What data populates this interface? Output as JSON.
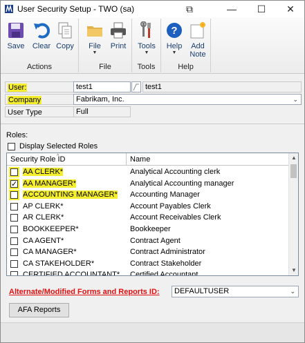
{
  "window": {
    "title": "User Security Setup  -  TWO (sa)",
    "controls": {
      "extra": "⧉",
      "minimize": "—",
      "maximize": "☐",
      "close": "✕"
    }
  },
  "ribbon": {
    "groups": [
      {
        "label": "Actions",
        "buttons": [
          {
            "label": "Save",
            "icon": "save-icon"
          },
          {
            "label": "Clear",
            "icon": "undo-icon"
          },
          {
            "label": "Copy",
            "icon": "copy-icon"
          }
        ]
      },
      {
        "label": "File",
        "buttons": [
          {
            "label": "File",
            "icon": "folder-icon",
            "dropdown": true
          },
          {
            "label": "Print",
            "icon": "printer-icon"
          }
        ]
      },
      {
        "label": "Tools",
        "buttons": [
          {
            "label": "Tools",
            "icon": "tools-icon",
            "dropdown": true
          }
        ]
      },
      {
        "label": "Help",
        "buttons": [
          {
            "label": "Help",
            "icon": "help-icon",
            "dropdown": true
          },
          {
            "label": "Add\nNote",
            "icon": "note-icon"
          }
        ]
      }
    ],
    "dropdown_arrow": "▼"
  },
  "fields": {
    "user_label": "User:",
    "user_value": "test1",
    "user_name_value": "test1",
    "company_label": "Company",
    "company_value": "Fabrikam, Inc.",
    "user_type_label": "User Type",
    "user_type_value": "Full",
    "dropdown_chevron": "⌄"
  },
  "roles": {
    "label": "Roles:",
    "display_selected_label": "Display Selected Roles",
    "display_selected_checked": false,
    "columns": {
      "role_id": "Security Role ID",
      "name": "Name"
    },
    "rows": [
      {
        "role": "AA CLERK*",
        "name": "Analytical Accounting clerk",
        "checked": false,
        "highlight": true
      },
      {
        "role": "AA MANAGER*",
        "name": "Analytical Accounting manager",
        "checked": true,
        "highlight": true
      },
      {
        "role": "ACCOUNTING MANAGER*",
        "name": "Accounting Manager",
        "checked": false,
        "highlight": true
      },
      {
        "role": "AP CLERK*",
        "name": "Account Payables Clerk",
        "checked": false,
        "highlight": false
      },
      {
        "role": "AR CLERK*",
        "name": "Account Receivables Clerk",
        "checked": false,
        "highlight": false
      },
      {
        "role": "BOOKKEEPER*",
        "name": "Bookkeeper",
        "checked": false,
        "highlight": false
      },
      {
        "role": "CA AGENT*",
        "name": "Contract Agent",
        "checked": false,
        "highlight": false
      },
      {
        "role": "CA MANAGER*",
        "name": "Contract Administrator",
        "checked": false,
        "highlight": false
      },
      {
        "role": "CA STAKEHOLDER*",
        "name": "Contract Stakeholder",
        "checked": false,
        "highlight": false
      },
      {
        "role": "CERTIFIED ACCOUNTANT*",
        "name": "Certified Accountant",
        "checked": false,
        "highlight": false
      }
    ]
  },
  "afa": {
    "label": "Alternate/Modified Forms and Reports ID:",
    "value": "DEFAULTUSER",
    "button_label": "AFA Reports"
  },
  "colors": {
    "highlight": "#f5ee2f",
    "afa_label": "#e01010",
    "ribbon_text": "#1a3d6e"
  }
}
